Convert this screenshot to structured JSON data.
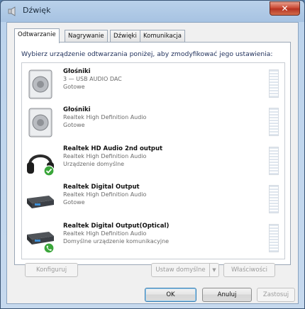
{
  "window": {
    "title": "Dźwięk",
    "close_label": "✕"
  },
  "tabs": [
    {
      "label": "Odtwarzanie",
      "active": true
    },
    {
      "label": "Nagrywanie",
      "active": false
    },
    {
      "label": "Dźwięki",
      "active": false
    },
    {
      "label": "Komunikacja",
      "active": false
    }
  ],
  "instruction": "Wybierz urządzenie odtwarzania poniżej, aby zmodyfikować jego ustawienia:",
  "devices": [
    {
      "name": "Głośniki",
      "description": "3 — USB AUDIO   DAC",
      "status": "Gotowe",
      "icon": "speaker-icon",
      "badge": ""
    },
    {
      "name": "Głośniki",
      "description": "Realtek High Definition Audio",
      "status": "Gotowe",
      "icon": "speaker-icon",
      "badge": ""
    },
    {
      "name": "Realtek HD Audio 2nd output",
      "description": "Realtek High Definition Audio",
      "status": "Urządzenie domyślne",
      "icon": "headphones-icon",
      "badge": "default-check-icon"
    },
    {
      "name": "Realtek Digital Output",
      "description": "Realtek High Definition Audio",
      "status": "Gotowe",
      "icon": "digital-output-icon",
      "badge": ""
    },
    {
      "name": "Realtek Digital Output(Optical)",
      "description": "Realtek High Definition Audio",
      "status": "Domyślne urządzenie komunikacyjne",
      "icon": "digital-output-icon",
      "badge": "communication-phone-icon"
    }
  ],
  "buttons": {
    "configure": "Konfiguruj",
    "set_default": "Ustaw domyślne",
    "properties": "Właściwości",
    "ok": "OK",
    "cancel": "Anuluj",
    "apply": "Zastosuj"
  },
  "colors": {
    "accent": "#3c7fb1",
    "default_badge": "#3aa63a"
  }
}
